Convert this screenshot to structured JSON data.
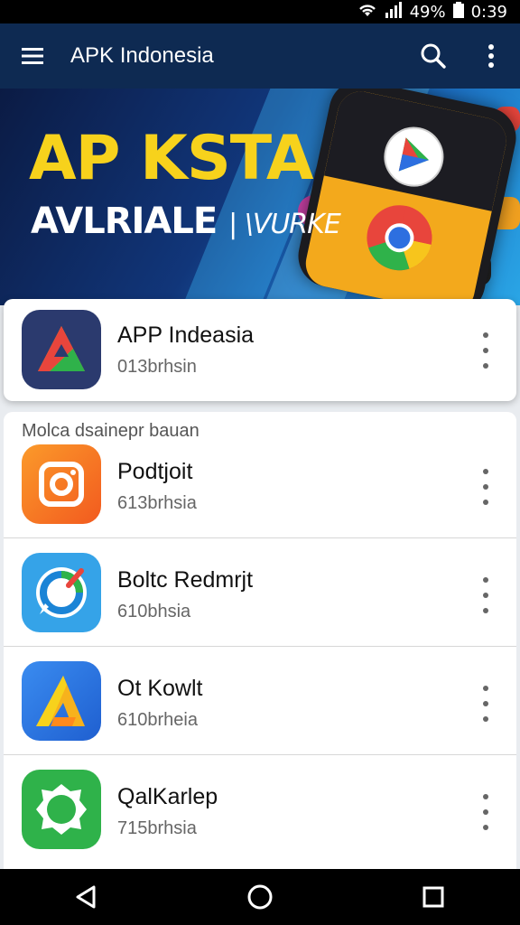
{
  "status_bar": {
    "battery": "49%",
    "time": "0:39"
  },
  "app_bar": {
    "title": "APK Indonesia",
    "icons": [
      "menu-icon",
      "search-icon",
      "more-vert-icon"
    ]
  },
  "banner": {
    "headline": "AP KSTA",
    "subheadline": "AVLRIALE",
    "subheadline_extra": "| \\VURKE"
  },
  "featured_app": {
    "name": "APP Indeasia",
    "subtitle": "013brhsin"
  },
  "section": {
    "header": "Molca dsainepr bauan"
  },
  "apps": [
    {
      "name": "Podtjoit",
      "subtitle": "613brhsia",
      "icon": "camera-icon",
      "color": "#f46b1f"
    },
    {
      "name": "Boltc Redmrjt",
      "subtitle": "610bhsia",
      "icon": "compass-icon",
      "color": "#35a3e8"
    },
    {
      "name": "Ot Kowlt",
      "subtitle": "610brheia",
      "icon": "triangle-icon",
      "color": "#2d6fe0"
    },
    {
      "name": "QalKarlep",
      "subtitle": "715brhsia",
      "icon": "ring-icon",
      "color": "#2fb24a"
    }
  ],
  "nav_bar": {
    "icons": [
      "back-icon",
      "home-icon",
      "recents-icon"
    ]
  }
}
